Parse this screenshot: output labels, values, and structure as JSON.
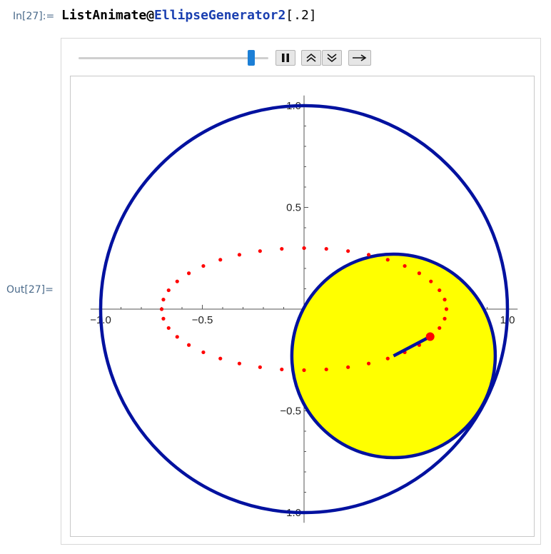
{
  "input": {
    "label": "In[27]:=",
    "code_func": "ListAnimate@",
    "code_name": "EllipseGenerator2",
    "code_args": "[.2]"
  },
  "output": {
    "label": "Out[27]="
  },
  "controls": {
    "slider_value": 0.9,
    "pause_icon": "pause-icon",
    "faster_icon": "chevron-double-up-icon",
    "slower_icon": "chevron-double-down-icon",
    "direction_icon": "right-arrow-icon"
  },
  "colors": {
    "circle": "#00119f",
    "disk_fill": "#ffff00",
    "points": "#ff0000",
    "rod": "#00119f"
  },
  "chart_data": {
    "type": "scatter",
    "xlim": [
      -1.0,
      1.0
    ],
    "ylim": [
      -1.0,
      1.0
    ],
    "x_ticks": [
      "-1.0",
      "-0.5",
      "0.5",
      "1.0"
    ],
    "x_tick_values": [
      -1.0,
      -0.5,
      0.5,
      1.0
    ],
    "y_ticks": [
      "1.0",
      "0.5",
      "-0.5",
      "-1.0"
    ],
    "y_tick_values": [
      1.0,
      0.5,
      -0.5,
      -1.0
    ],
    "outer_circle": {
      "cx": 0,
      "cy": 0,
      "r": 1.0
    },
    "inner_circle": {
      "cx": 0.44,
      "cy": -0.23,
      "r": 0.5
    },
    "rod": {
      "x1": 0.44,
      "y1": -0.23,
      "x2": 0.62,
      "y2": -0.135
    },
    "tracer_point": {
      "x": 0.62,
      "y": -0.135
    },
    "ellipse_points": {
      "center": [
        0,
        0
      ],
      "semi_axis_x": 0.7,
      "semi_axis_y": 0.3,
      "count": 40
    }
  }
}
